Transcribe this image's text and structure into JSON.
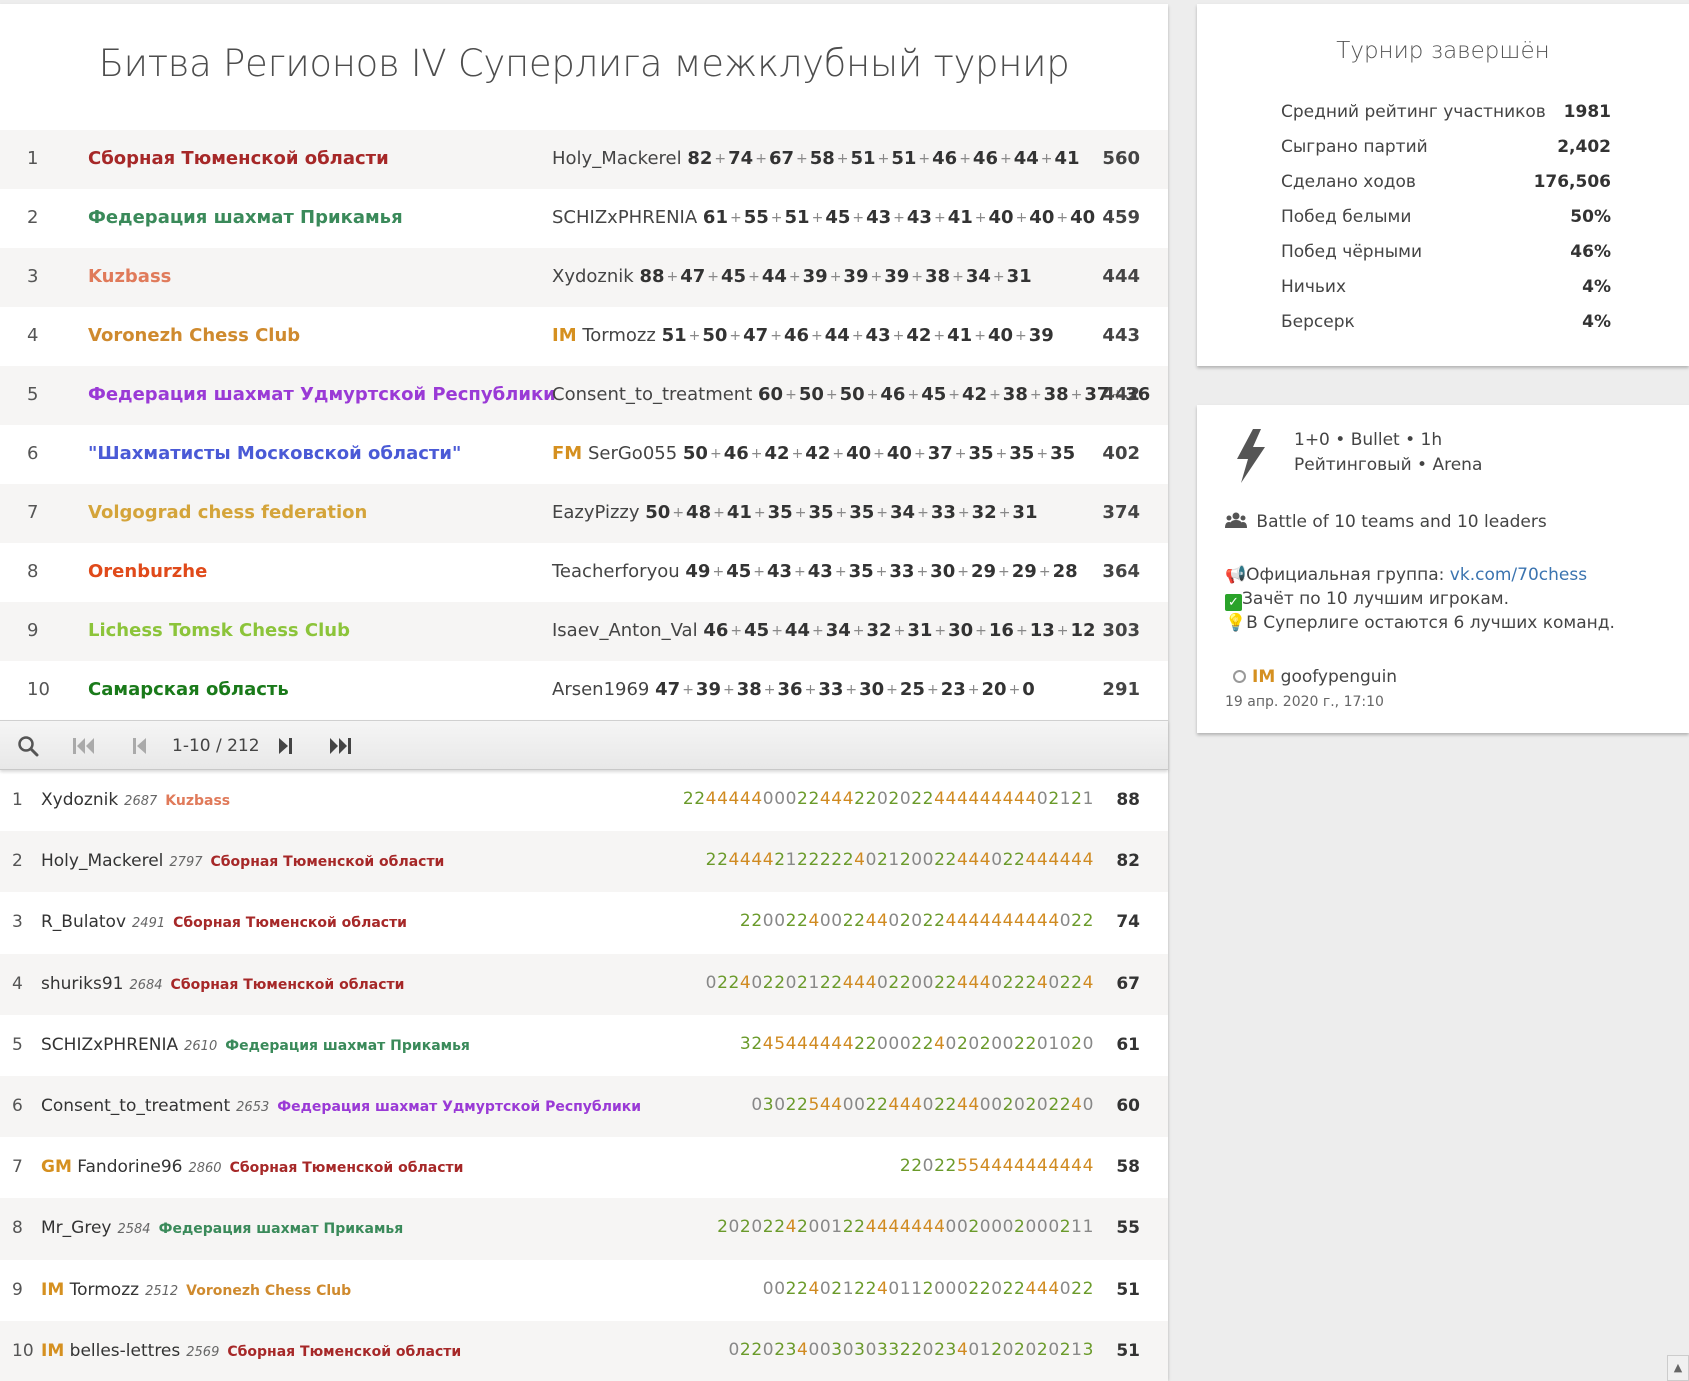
{
  "title": "Битва Регионов IV Суперлига межклубный турнир",
  "teams": [
    {
      "rank": "1",
      "name": "Сборная Тюменской области",
      "color": "#a62828",
      "badge": "",
      "leader": "Holy_Mackerel",
      "scores": [
        "82",
        "74",
        "67",
        "58",
        "51",
        "51",
        "46",
        "46",
        "44",
        "41"
      ],
      "total": "560"
    },
    {
      "rank": "2",
      "name": "Федерация шахмат Прикамья",
      "color": "#3a8a5a",
      "badge": "",
      "leader": "SCHIZxPHRENIA",
      "scores": [
        "61",
        "55",
        "51",
        "45",
        "43",
        "43",
        "41",
        "40",
        "40",
        "40"
      ],
      "total": "459"
    },
    {
      "rank": "3",
      "name": "Kuzbass",
      "color": "#e07a5a",
      "badge": "",
      "leader": "Xydoznik",
      "scores": [
        "88",
        "47",
        "45",
        "44",
        "39",
        "39",
        "39",
        "38",
        "34",
        "31"
      ],
      "total": "444"
    },
    {
      "rank": "4",
      "name": "Voronezh Chess Club",
      "color": "#cf8a2e",
      "badge": "IM",
      "leader": "Tormozz",
      "scores": [
        "51",
        "50",
        "47",
        "46",
        "44",
        "43",
        "42",
        "41",
        "40",
        "39"
      ],
      "total": "443"
    },
    {
      "rank": "5",
      "name": "Федерация шахмат Удмуртской Республики",
      "color": "#9a3ad6",
      "badge": "",
      "leader": "Consent_to_treatment",
      "scores": [
        "60",
        "50",
        "50",
        "46",
        "45",
        "42",
        "38",
        "38",
        "37",
        "36"
      ],
      "total": "442"
    },
    {
      "rank": "6",
      "name": "\"Шахматисты Московской области\"",
      "color": "#4a5ad6",
      "badge": "FM",
      "leader": "SerGo055",
      "scores": [
        "50",
        "46",
        "42",
        "42",
        "40",
        "40",
        "37",
        "35",
        "35",
        "35"
      ],
      "total": "402"
    },
    {
      "rank": "7",
      "name": "Volgograd chess federation",
      "color": "#d4a43a",
      "badge": "",
      "leader": "EazyPizzy",
      "scores": [
        "50",
        "48",
        "41",
        "35",
        "35",
        "35",
        "34",
        "33",
        "32",
        "31"
      ],
      "total": "374"
    },
    {
      "rank": "8",
      "name": "Orenburzhe",
      "color": "#e04a1a",
      "badge": "",
      "leader": "Teacherforyou",
      "scores": [
        "49",
        "45",
        "43",
        "43",
        "35",
        "33",
        "30",
        "29",
        "29",
        "28"
      ],
      "total": "364"
    },
    {
      "rank": "9",
      "name": "Lichess Tomsk Chess Club",
      "color": "#8cc43a",
      "badge": "",
      "leader": "Isaev_Anton_Val",
      "scores": [
        "46",
        "45",
        "44",
        "34",
        "32",
        "31",
        "30",
        "16",
        "13",
        "12"
      ],
      "total": "303"
    },
    {
      "rank": "10",
      "name": "Самарская область",
      "color": "#1a7a1a",
      "badge": "",
      "leader": "Arsen1969",
      "scores": [
        "47",
        "39",
        "38",
        "36",
        "33",
        "30",
        "25",
        "23",
        "20",
        "0"
      ],
      "total": "291"
    }
  ],
  "pager": {
    "range": "1-10 / 212"
  },
  "players": [
    {
      "rank": "1",
      "badge": "",
      "name": "Xydoznik",
      "rating": "2687",
      "team": "Kuzbass",
      "team_color": "#e07a5a",
      "sheet": "224444400022444220202244444444402121",
      "score": "88"
    },
    {
      "rank": "2",
      "badge": "",
      "name": "Holy_Mackerel",
      "rating": "2797",
      "team": "Сборная Тюменской области",
      "team_color": "#a62828",
      "sheet": "2244442122222402120022444022444444",
      "score": "82"
    },
    {
      "rank": "3",
      "badge": "",
      "name": "R_Bulatov",
      "rating": "2491",
      "team": "Сборная Тюменской области",
      "team_color": "#a62828",
      "sheet": "2200224002244020224444444444022",
      "score": "74"
    },
    {
      "rank": "4",
      "badge": "",
      "name": "shuriks91",
      "rating": "2684",
      "team": "Сборная Тюменской области",
      "team_color": "#a62828",
      "sheet": "0224022021224440220022444022240224",
      "score": "67"
    },
    {
      "rank": "5",
      "badge": "",
      "name": "SCHIZxPHRENIA",
      "rating": "2610",
      "team": "Федерация шахмат Прикамья",
      "team_color": "#3a8a5a",
      "sheet": "3245444444220002240202002201020",
      "score": "61"
    },
    {
      "rank": "6",
      "badge": "",
      "name": "Consent_to_treatment",
      "rating": "2653",
      "team": "Федерация шахмат Удмуртской Республики",
      "team_color": "#9a3ad6",
      "sheet": "03022544002244402244002020 2240",
      "score": "60"
    },
    {
      "rank": "7",
      "badge": "GM",
      "name": "Fandorine96",
      "rating": "2860",
      "team": "Сборная Тюменской области",
      "team_color": "#a62828",
      "sheet": "22022554444444444",
      "score": "58"
    },
    {
      "rank": "8",
      "badge": "",
      "name": "Mr_Grey",
      "rating": "2584",
      "team": "Федерация шахмат Прикамья",
      "team_color": "#3a8a5a",
      "sheet": "2020224200122444444400200020002 11",
      "score": "55"
    },
    {
      "rank": "9",
      "badge": "IM",
      "name": "Tormozz",
      "rating": "2512",
      "team": "Voronezh Chess Club",
      "team_color": "#cf8a2e",
      "sheet": "00224021224011200022022444022",
      "score": "51"
    },
    {
      "rank": "10",
      "badge": "IM",
      "name": "belles-lettres",
      "rating": "2569",
      "team": "Сборная Тюменской области",
      "team_color": "#a62828",
      "sheet": "0220234003030332202340120202021 3",
      "score": "51"
    }
  ],
  "stats": {
    "status": "Турнир завершён",
    "rows": [
      {
        "label": "Средний рейтинг участников",
        "value": "1981"
      },
      {
        "label": "Сыграно партий",
        "value": "2,402"
      },
      {
        "label": "Сделано ходов",
        "value": "176,506"
      },
      {
        "label": "Побед белыми",
        "value": "50%"
      },
      {
        "label": "Побед чёрными",
        "value": "46%"
      },
      {
        "label": "Ничьих",
        "value": "4%"
      },
      {
        "label": "Берсерк",
        "value": "4%"
      }
    ]
  },
  "info": {
    "speed": "1+0 • Bullet • 1h",
    "mode": "Рейтинговый • Arena",
    "battle": "Battle of 10 teams and 10 leaders",
    "group_label": "Официальная группа: ",
    "group_link": "vk.com/70chess",
    "count_rule": "Зачёт по 10 лучшим игрокам.",
    "stay_rule": "В Суперлиге остаются 6 лучших команд.",
    "creator_badge": "IM",
    "creator": "goofypenguin",
    "date": "19 апр. 2020 г., 17:10"
  },
  "colors": {
    "accent_title": "#d59020",
    "sheet_green": "#6a9a2a",
    "sheet_orange": "#d08a20",
    "sheet_gray": "#888888"
  }
}
